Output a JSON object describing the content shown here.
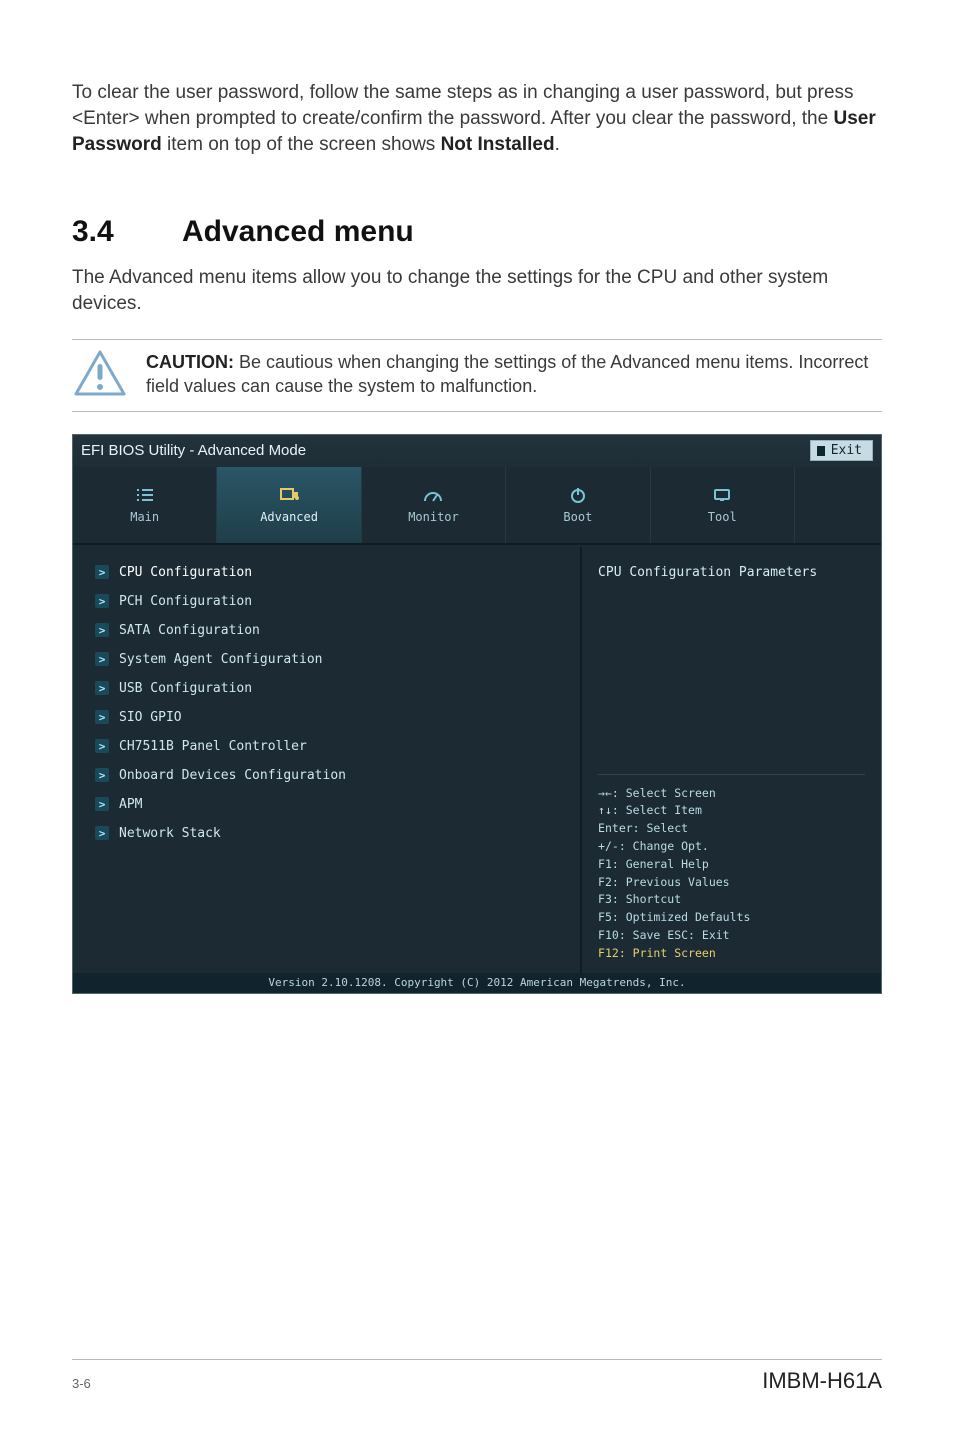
{
  "intro": {
    "text_pre": "To clear the user password, follow the same steps as in changing a user password, but press <Enter> when prompted to create/confirm the password. After you clear the password, the ",
    "bold1": "User Password",
    "mid": " item on top of the screen shows ",
    "bold2": "Not Installed",
    "end": "."
  },
  "section": {
    "num": "3.4",
    "title": "Advanced menu",
    "desc": "The Advanced menu items allow you to change the settings for the CPU and other system devices."
  },
  "caution": {
    "label": "CAUTION:",
    "text": "  Be cautious when changing the settings of the Advanced menu items. Incorrect field values can cause the system to malfunction."
  },
  "bios": {
    "title": "EFI BIOS Utility - Advanced Mode",
    "exit": "Exit",
    "tabs": [
      {
        "name": "main",
        "label": "Main",
        "icon": "list-icon"
      },
      {
        "name": "advanced",
        "label": "Advanced",
        "icon": "chip-icon"
      },
      {
        "name": "monitor",
        "label": "Monitor",
        "icon": "gauge-icon"
      },
      {
        "name": "boot",
        "label": "Boot",
        "icon": "power-icon"
      },
      {
        "name": "tool",
        "label": "Tool",
        "icon": "tool-icon"
      }
    ],
    "active_tab": "Advanced",
    "menu": [
      {
        "label": "CPU Configuration",
        "selected": true
      },
      {
        "label": "PCH Configuration"
      },
      {
        "label": "SATA Configuration"
      },
      {
        "label": "System Agent Configuration"
      },
      {
        "label": "USB Configuration"
      },
      {
        "label": "SIO GPIO"
      },
      {
        "label": "CH7511B Panel Controller"
      },
      {
        "label": "Onboard Devices Configuration"
      },
      {
        "label": "APM"
      },
      {
        "label": "Network Stack"
      }
    ],
    "info_title": "CPU Configuration Parameters",
    "help": {
      "l1": "→←: Select Screen",
      "l2": "↑↓: Select Item",
      "l3": "Enter: Select",
      "l4": "+/-: Change Opt.",
      "l5": "F1: General Help",
      "l6": "F2: Previous Values",
      "l7": "F3: Shortcut",
      "l8": "F5: Optimized Defaults",
      "l9": "F10: Save  ESC: Exit",
      "l10": "F12: Print Screen"
    },
    "footer": "Version 2.10.1208. Copyright (C) 2012 American Megatrends, Inc."
  },
  "page_footer": {
    "left": "3-6",
    "right": "IMBM-H61A"
  }
}
